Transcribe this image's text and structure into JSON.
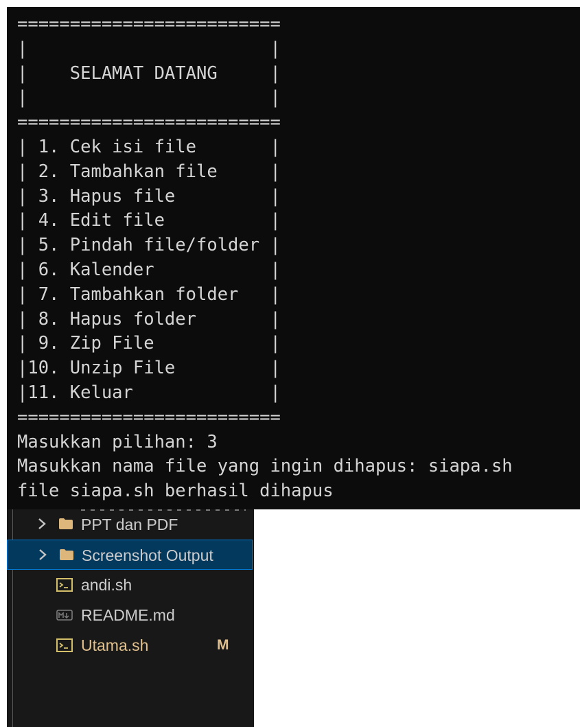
{
  "terminal": {
    "lines": [
      "=========================",
      "|                       |",
      "|    SELAMAT DATANG     |",
      "|                       |",
      "=========================",
      "| 1. Cek isi file       |",
      "| 2. Tambahkan file     |",
      "| 3. Hapus file         |",
      "| 4. Edit file          |",
      "| 5. Pindah file/folder |",
      "| 6. Kalender           |",
      "| 7. Tambahkan folder   |",
      "| 8. Hapus folder       |",
      "| 9. Zip File           |",
      "|10. Unzip File         |",
      "|11. Keluar             |",
      "=========================",
      "Masukkan pilihan: 3",
      "Masukkan nama file yang ingin dihapus: siapa.sh",
      "file siapa.sh berhasil dihapus"
    ]
  },
  "explorer": {
    "items": [
      {
        "label": "PPT dan PDF",
        "kind": "folder",
        "icon": "folder-icon",
        "expandable": true,
        "selected": false
      },
      {
        "label": "Screenshot Output",
        "kind": "folder",
        "icon": "folder-icon",
        "expandable": true,
        "selected": true
      },
      {
        "label": "andi.sh",
        "kind": "file",
        "icon": "terminal-file-icon",
        "selected": false
      },
      {
        "label": "README.md",
        "kind": "file",
        "icon": "markdown-file-icon",
        "selected": false
      },
      {
        "label": "Utama.sh",
        "kind": "file",
        "icon": "terminal-file-icon",
        "selected": false,
        "modified": true,
        "badge": "M"
      }
    ]
  },
  "colors": {
    "terminal_bg": "#0c0c0c",
    "terminal_text": "#d4d4d4",
    "explorer_bg": "#181818",
    "selection_bg": "#04395e",
    "selection_border": "#0078d4",
    "modified": "#e2c08d",
    "folder": "#dcb67a"
  }
}
